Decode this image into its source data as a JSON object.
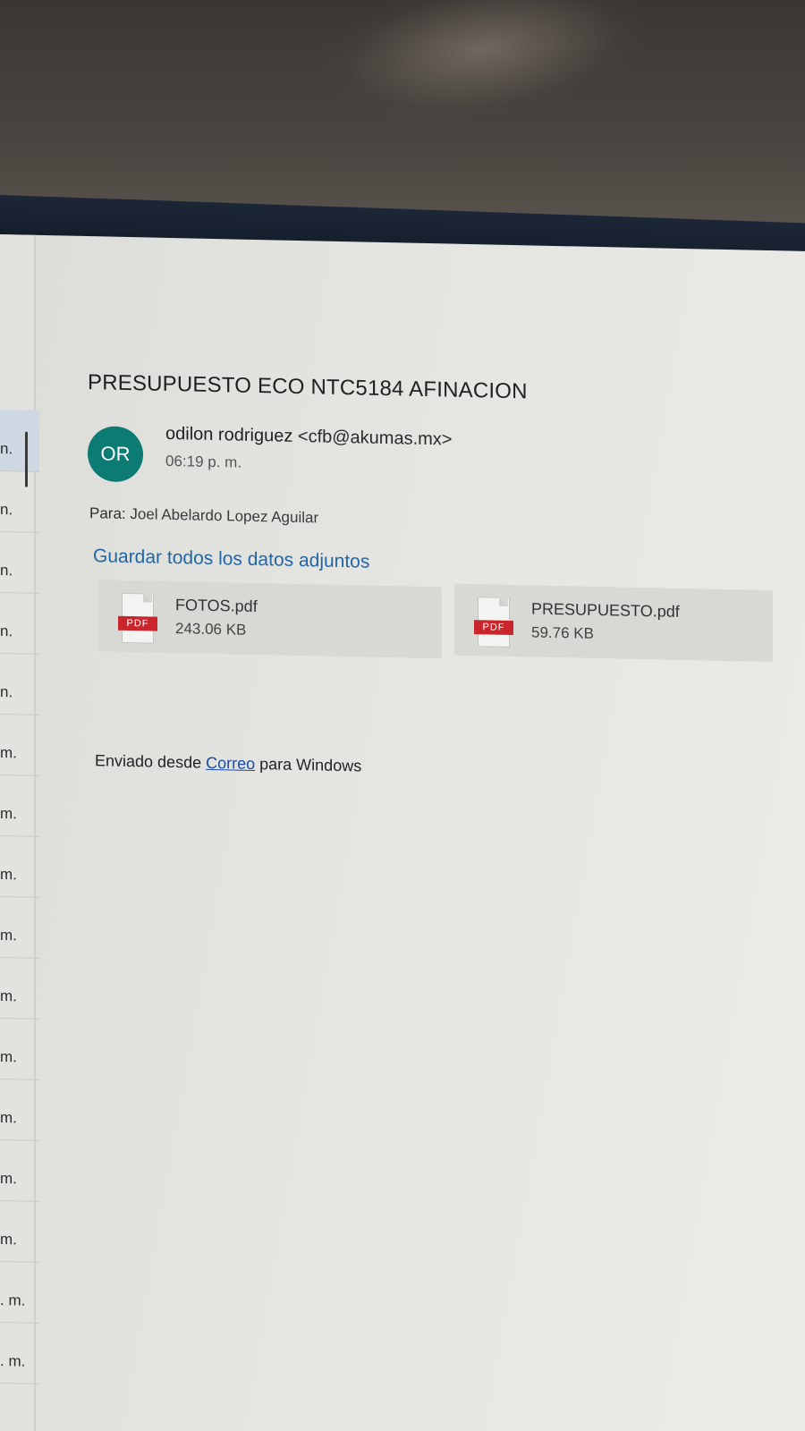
{
  "email": {
    "subject": "PRESUPUESTO ECO NTC5184 AFINACION",
    "sender": {
      "initials": "OR",
      "name": "odilon rodriguez",
      "address": "<cfb@akumas.mx>",
      "time": "06:19 p. m.",
      "avatar_color": "#0b7b73"
    },
    "to": {
      "label": "Para:",
      "recipient": "Joel Abelardo Lopez Aguilar"
    },
    "save_all_label": "Guardar todos los datos adjuntos",
    "attachments": [
      {
        "name": "FOTOS.pdf",
        "size": "243.06 KB",
        "badge": "PDF",
        "icon": "pdf-file-icon"
      },
      {
        "name": "PRESUPUESTO.pdf",
        "size": "59.76 KB",
        "badge": "PDF",
        "icon": "pdf-file-icon"
      }
    ],
    "body": {
      "prefix": "Enviado desde",
      "link": "Correo",
      "suffix": "para Windows"
    }
  },
  "message_list": {
    "partial_times": [
      "n.",
      "n.",
      "n.",
      "n.",
      "n.",
      "m.",
      "m.",
      "m.",
      "m.",
      "m.",
      "m.",
      "m.",
      "m.",
      "m.",
      ". m.",
      ". m."
    ]
  },
  "colors": {
    "link": "#2266a6",
    "pdf_badge": "#c8262c"
  }
}
